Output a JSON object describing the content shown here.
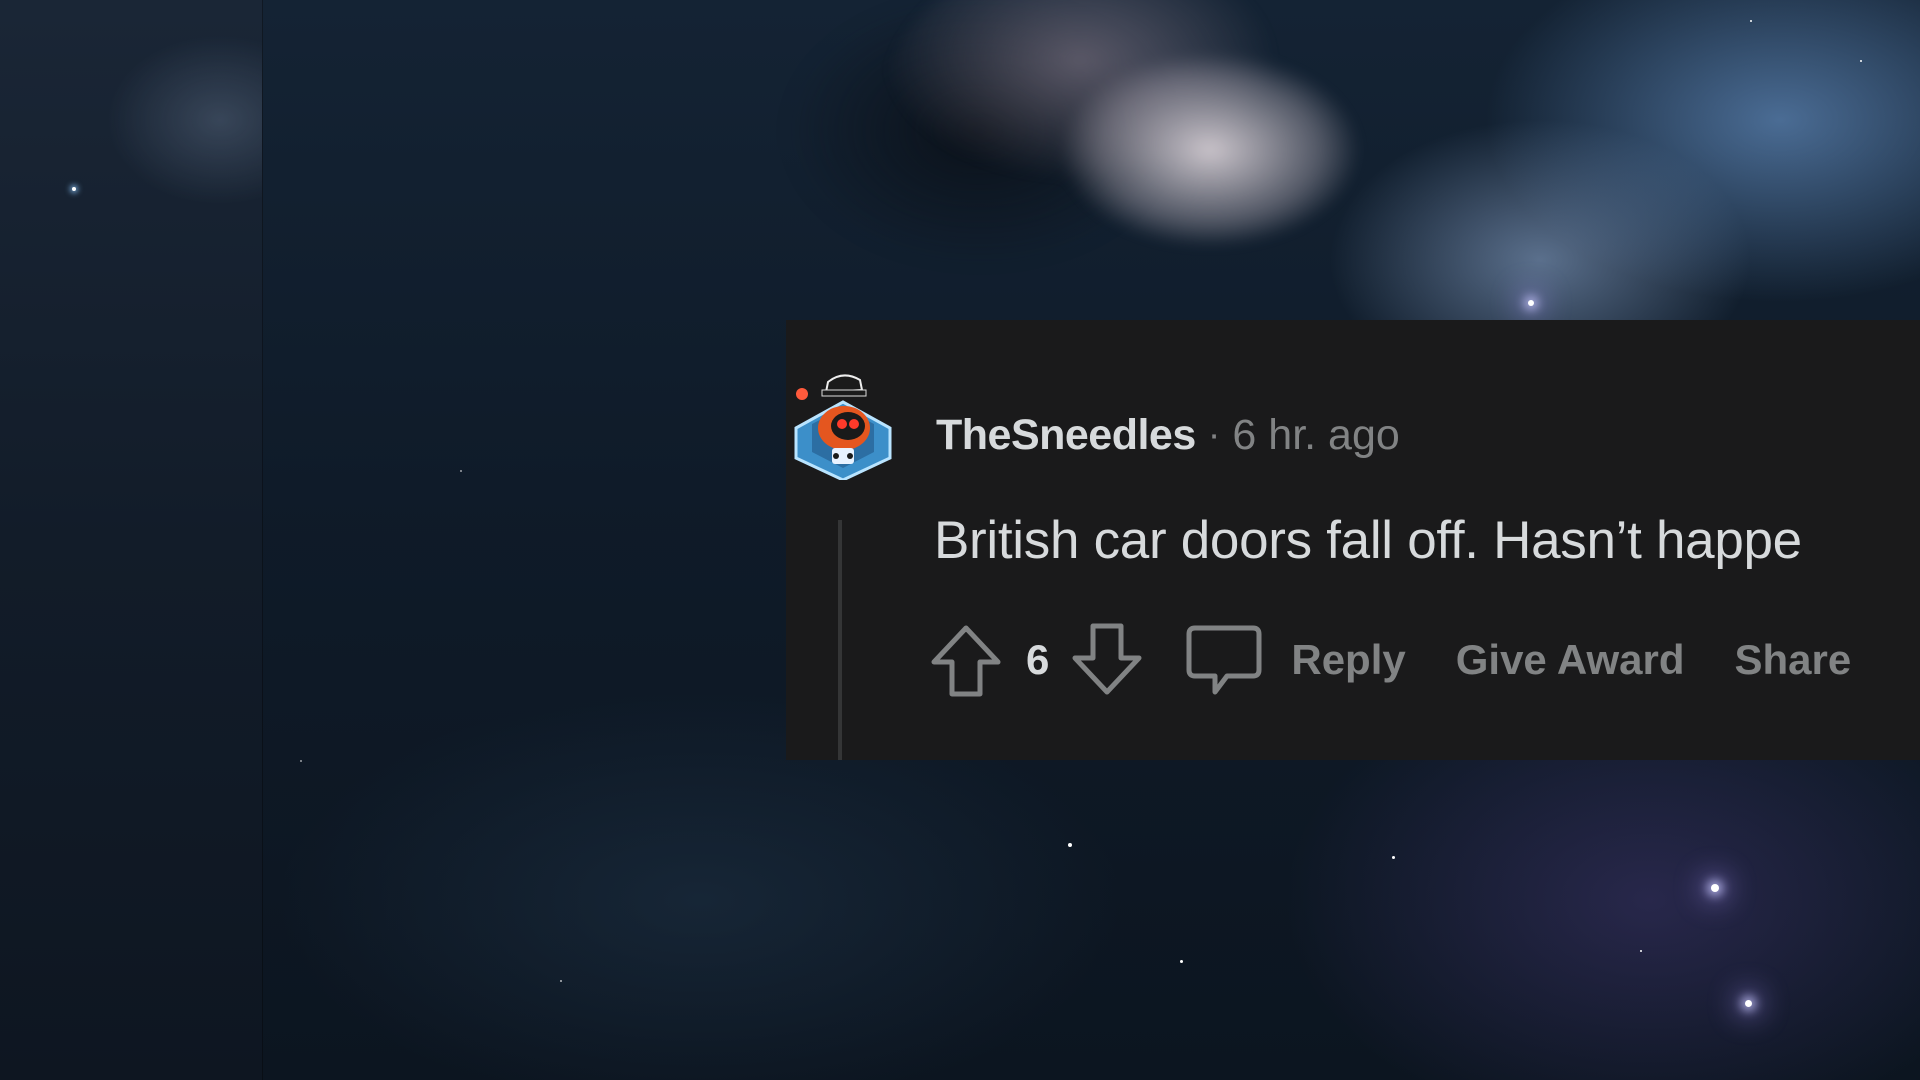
{
  "comment": {
    "author": "TheSneedles",
    "separator": "·",
    "timestamp": "6 hr. ago",
    "body": "British car doors fall off. Hasn’t happe",
    "score": "6"
  },
  "actions": {
    "upvote_icon": "arrow-up-outline-icon",
    "downvote_icon": "arrow-down-outline-icon",
    "reply_icon": "speech-bubble-icon",
    "reply_label": "Reply",
    "award_label": "Give Award",
    "share_label": "Share"
  },
  "colors": {
    "card_background": "#1a1a1b",
    "primary_text": "#d7dadc",
    "muted_text": "#818384",
    "thread_line": "#343536"
  },
  "avatar": {
    "icon": "snoo-robot-avatar-icon"
  }
}
